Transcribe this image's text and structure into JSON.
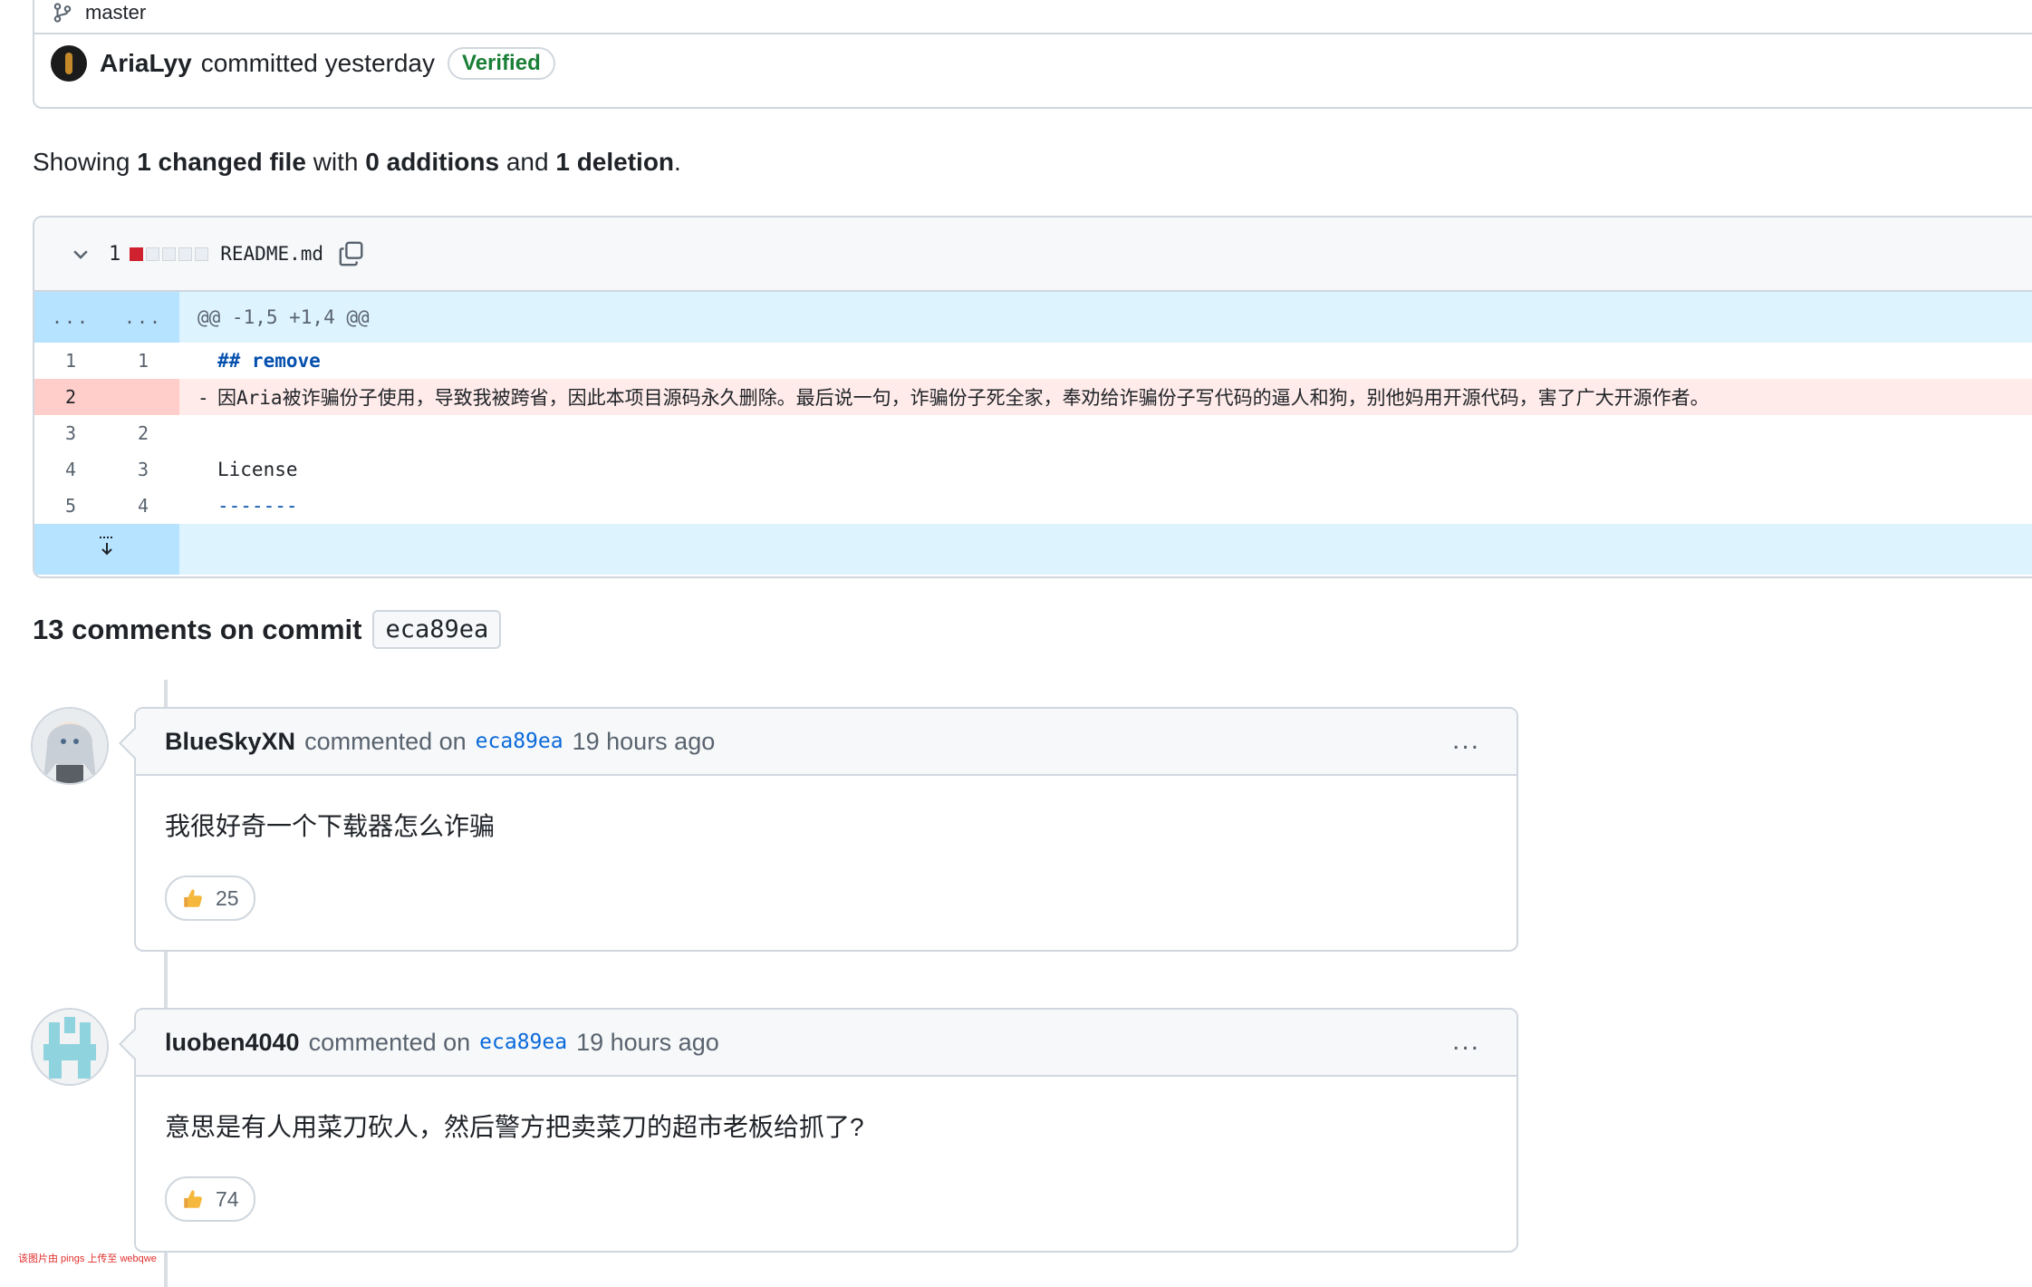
{
  "commit": {
    "branch": "master",
    "author": "AriaLyy",
    "action": "committed yesterday",
    "verified_label": "Verified"
  },
  "summary": {
    "prefix": "Showing",
    "changed": "1 changed file",
    "with": "with",
    "additions": "0 additions",
    "and": "and",
    "deletions": "1 deletion",
    "suffix": "."
  },
  "file": {
    "diffstat_count": "1",
    "name": "README.md",
    "hunk_header": "@@ -1,5 +1,4 @@",
    "hunk_ln": "...",
    "lines": [
      {
        "old": "1",
        "new": "1",
        "marker": "",
        "text": "## remove"
      },
      {
        "old": "2",
        "new": "",
        "marker": "-",
        "text": "因Aria被诈骗份子使用，导致我被跨省，因此本项目源码永久删除。最后说一句，诈骗份子死全家，奉劝给诈骗份子写代码的逼人和狗，别他妈用开源代码，害了广大开源作者。"
      },
      {
        "old": "3",
        "new": "2",
        "marker": "",
        "text": ""
      },
      {
        "old": "4",
        "new": "3",
        "marker": "",
        "text": "License"
      },
      {
        "old": "5",
        "new": "4",
        "marker": "",
        "text": "-------"
      }
    ]
  },
  "comments_header": {
    "title": "13 comments on commit",
    "sha": "eca89ea"
  },
  "comments": [
    {
      "author": "BlueSkyXN",
      "action": "commented on",
      "sha": "eca89ea",
      "time": "19 hours ago",
      "menu": "...",
      "body": "我很好奇一个下载器怎么诈骗",
      "reaction_count": "25"
    },
    {
      "author": "luoben4040",
      "action": "commented on",
      "sha": "eca89ea",
      "time": "19 hours ago",
      "menu": "...",
      "body": "意思是有人用菜刀砍人，然后警方把卖菜刀的超市老板给抓了?",
      "reaction_count": "74"
    }
  ],
  "watermark": "该图片由 pings 上传至 webqwe",
  "colors": {
    "verified": "#1a7f37",
    "deletion": "#cf222e",
    "hunk_bg": "#ddf4ff",
    "link": "#0969da"
  }
}
